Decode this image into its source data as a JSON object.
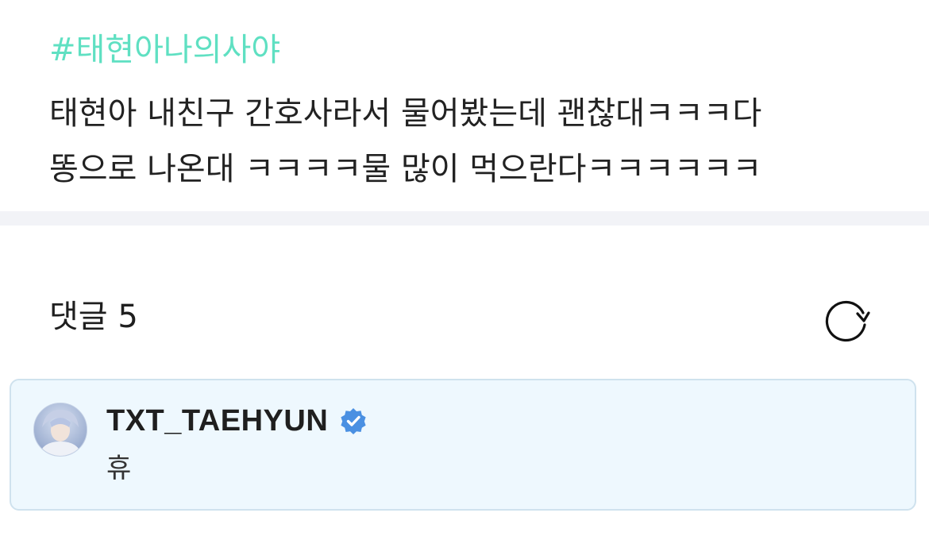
{
  "post": {
    "hashtag": "#태현아나의사야",
    "body_line_1": "태현아 내친구 간호사라서 물어봤는데 괜찮대ㅋㅋㅋ다",
    "body_line_2": "똥으로 나온대 ㅋㅋㅋㅋ물 많이 먹으란다ㅋㅋㅋㅋㅋㅋ",
    "hashtag_color": "#5fe0c2"
  },
  "comments": {
    "title": "댓글 5",
    "refresh_icon": "refresh-icon",
    "items": [
      {
        "author": "TXT_TAEHYUN",
        "verified": true,
        "verified_icon": "verified-badge-icon",
        "verified_color": "#4a90e2",
        "text": "휴",
        "highlighted": true,
        "card_color": "#eef8fe"
      }
    ]
  }
}
